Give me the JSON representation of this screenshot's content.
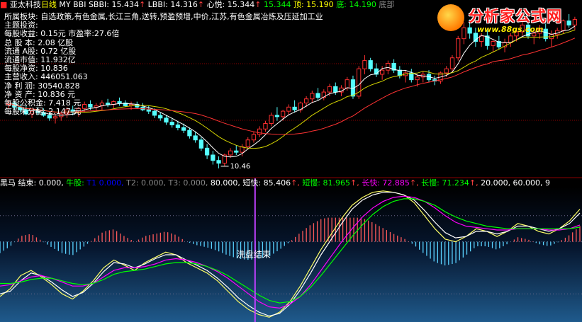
{
  "stock": {
    "name": "亚太科技",
    "period": "日线",
    "indicator": "MY BBI",
    "items": [
      {
        "label": "SBBI: ",
        "value": "15.434",
        "arrow": "↑",
        "color": "#ffffff"
      },
      {
        "label": "LBBI: ",
        "value": "14.316",
        "arrow": "↑",
        "color": "#ffffff"
      },
      {
        "label": "心悦: ",
        "value": "15.344",
        "arrow": "↑",
        "color": "#ffffff"
      },
      {
        "label": "",
        "value": "15.344",
        "arrow": "",
        "color": "#00ff00"
      },
      {
        "label": "顶: ",
        "value": "15.190",
        "arrow": "",
        "color": "#ffff00"
      },
      {
        "label": "底: ",
        "value": "14.190",
        "arrow": "",
        "color": "#00ff00"
      },
      {
        "label": "底部",
        "value": "",
        "arrow": "",
        "color": "#888888"
      }
    ]
  },
  "info_panel": [
    "所属板块: 自选政策,有色金属,长江三角,送转,预盈预增,中价,江苏,有色金属冶炼及压延加工业",
    "主题投资:",
    "每股收益: 0.15元  市盈率:27.6倍",
    "总 股 本: 2.08  亿股",
    "流通 A股: 0.72  亿股",
    "流通市值: 11.932亿",
    "每股净资: 10.836",
    "主营收入: 446051.063",
    "净 利 润: 30540.828",
    "净 资 产: 10.836 元",
    "每股公积金: 7.418 元",
    "每股未分配: 2.147 元"
  ],
  "logo": {
    "title": "分析家公式网",
    "url": "www.88gs.com"
  },
  "indicator_header": [
    {
      "text": "黑马 ",
      "color": "#ffffff"
    },
    {
      "text": "结束: 0.000, ",
      "color": "#ffffff"
    },
    {
      "text": "牛股: ",
      "color": "#00ff00"
    },
    {
      "text": "T1 ",
      "color": "#0000ff"
    },
    {
      "text": "0.000, ",
      "color": "#0000ff"
    },
    {
      "text": "T2: 0.000, ",
      "color": "#888888"
    },
    {
      "text": "T3: 0.000, ",
      "color": "#888888"
    },
    {
      "text": "80.000, ",
      "color": "#ffffff"
    },
    {
      "text": "短快: 85.406",
      "color": "#ffffff"
    },
    {
      "text": "↑, ",
      "color": "#ff4040"
    },
    {
      "text": "短慢: 81.965",
      "color": "#00ff00"
    },
    {
      "text": "↑, ",
      "color": "#ff4040"
    },
    {
      "text": "长快: 72.885",
      "color": "#ff00ff"
    },
    {
      "text": "↑, ",
      "color": "#ff4040"
    },
    {
      "text": "长慢: 71.234",
      "color": "#00ff00"
    },
    {
      "text": "↑, ",
      "color": "#ff4040"
    },
    {
      "text": "20.000, 60.000, ",
      "color": "#ffffff"
    },
    {
      "text": "9",
      "color": "#ffffff"
    }
  ],
  "chart_data": [
    {
      "type": "candlestick",
      "title": "亚太科技 日线",
      "low_annotation": "10.46",
      "ylim": [
        10.2,
        16.2
      ],
      "candles": [
        [
          12.8,
          12.95,
          12.65,
          12.85
        ],
        [
          12.85,
          12.9,
          12.6,
          12.7
        ],
        [
          12.7,
          12.8,
          12.5,
          12.6
        ],
        [
          12.6,
          12.75,
          12.4,
          12.45
        ],
        [
          12.45,
          12.6,
          12.3,
          12.55
        ],
        [
          12.55,
          12.7,
          12.4,
          12.5
        ],
        [
          12.5,
          12.65,
          12.35,
          12.4
        ],
        [
          12.4,
          12.55,
          12.2,
          12.3
        ],
        [
          12.3,
          12.45,
          12.1,
          12.35
        ],
        [
          12.35,
          12.5,
          12.2,
          12.45
        ],
        [
          12.45,
          12.7,
          12.3,
          12.6
        ],
        [
          12.6,
          12.75,
          12.4,
          12.5
        ],
        [
          12.5,
          12.7,
          12.35,
          12.65
        ],
        [
          12.65,
          12.9,
          12.5,
          12.8
        ],
        [
          12.8,
          12.95,
          12.6,
          12.7
        ],
        [
          12.7,
          12.85,
          12.55,
          12.75
        ],
        [
          12.75,
          12.95,
          12.6,
          12.85
        ],
        [
          12.85,
          13.0,
          12.7,
          12.8
        ],
        [
          12.8,
          12.95,
          12.65,
          12.9
        ],
        [
          12.9,
          13.05,
          12.75,
          12.85
        ],
        [
          12.85,
          12.95,
          12.7,
          12.75
        ],
        [
          12.75,
          12.9,
          12.6,
          12.8
        ],
        [
          12.8,
          12.9,
          12.65,
          12.7
        ],
        [
          12.7,
          12.85,
          12.55,
          12.6
        ],
        [
          12.6,
          12.75,
          12.45,
          12.55
        ],
        [
          12.55,
          12.65,
          12.3,
          12.4
        ],
        [
          12.4,
          12.5,
          12.2,
          12.3
        ],
        [
          12.3,
          12.4,
          12.05,
          12.15
        ],
        [
          12.15,
          12.3,
          11.95,
          12.05
        ],
        [
          12.05,
          12.2,
          11.85,
          11.95
        ],
        [
          11.95,
          12.1,
          11.75,
          11.85
        ],
        [
          11.85,
          11.95,
          11.55,
          11.65
        ],
        [
          11.65,
          11.8,
          11.4,
          11.5
        ],
        [
          11.5,
          11.6,
          11.1,
          11.2
        ],
        [
          11.2,
          11.35,
          10.8,
          10.95
        ],
        [
          10.95,
          11.1,
          10.6,
          10.75
        ],
        [
          10.75,
          10.9,
          10.46,
          10.65
        ],
        [
          10.65,
          11.0,
          10.55,
          10.95
        ],
        [
          10.95,
          11.2,
          10.85,
          11.1
        ],
        [
          11.1,
          11.3,
          10.95,
          11.05
        ],
        [
          11.05,
          11.35,
          10.9,
          11.25
        ],
        [
          11.25,
          11.6,
          11.15,
          11.5
        ],
        [
          11.5,
          11.8,
          11.4,
          11.7
        ],
        [
          11.7,
          12.0,
          11.6,
          11.9
        ],
        [
          11.9,
          12.2,
          11.8,
          12.1
        ],
        [
          12.1,
          12.5,
          12.0,
          12.4
        ],
        [
          12.4,
          12.7,
          12.2,
          12.35
        ],
        [
          12.35,
          12.6,
          12.2,
          12.55
        ],
        [
          12.55,
          12.8,
          12.4,
          12.7
        ],
        [
          12.7,
          12.95,
          12.5,
          12.6
        ],
        [
          12.6,
          12.9,
          12.5,
          12.85
        ],
        [
          12.85,
          13.1,
          12.7,
          13.0
        ],
        [
          13.0,
          13.3,
          12.85,
          13.2
        ],
        [
          13.2,
          13.4,
          12.95,
          13.05
        ],
        [
          13.05,
          13.35,
          12.95,
          13.25
        ],
        [
          13.25,
          13.55,
          13.1,
          13.45
        ],
        [
          13.45,
          13.6,
          13.15,
          13.25
        ],
        [
          13.25,
          13.5,
          13.1,
          13.4
        ],
        [
          13.4,
          13.8,
          13.3,
          13.7
        ],
        [
          13.7,
          13.85,
          13.0,
          13.1
        ],
        [
          13.1,
          14.2,
          13.0,
          14.1
        ],
        [
          14.1,
          14.6,
          13.9,
          14.4
        ],
        [
          14.4,
          14.5,
          14.0,
          14.1
        ],
        [
          14.1,
          14.3,
          13.8,
          13.9
        ],
        [
          13.9,
          14.2,
          13.7,
          14.05
        ],
        [
          14.05,
          14.4,
          13.9,
          14.3
        ],
        [
          14.3,
          14.45,
          13.95,
          14.05
        ],
        [
          14.05,
          14.2,
          13.75,
          13.85
        ],
        [
          13.85,
          14.05,
          13.6,
          13.95
        ],
        [
          13.95,
          14.1,
          13.6,
          13.7
        ],
        [
          13.7,
          13.9,
          13.45,
          13.8
        ],
        [
          13.8,
          14.0,
          13.6,
          13.9
        ],
        [
          13.9,
          14.05,
          13.6,
          13.7
        ],
        [
          13.7,
          13.85,
          13.5,
          13.65
        ],
        [
          13.65,
          14.0,
          13.55,
          13.95
        ],
        [
          13.95,
          14.2,
          13.8,
          14.1
        ],
        [
          14.1,
          14.6,
          14.0,
          14.5
        ],
        [
          14.5,
          15.3,
          14.4,
          15.2
        ],
        [
          15.2,
          15.8,
          15.0,
          15.6
        ],
        [
          15.6,
          15.9,
          15.2,
          15.4
        ],
        [
          15.4,
          15.6,
          14.9,
          15.1
        ],
        [
          15.1,
          15.4,
          14.9,
          15.3
        ],
        [
          15.3,
          15.5,
          14.8,
          14.95
        ],
        [
          14.95,
          15.2,
          14.7,
          15.1
        ],
        [
          15.1,
          15.3,
          14.8,
          14.9
        ],
        [
          14.9,
          15.2,
          14.7,
          15.05
        ],
        [
          15.05,
          15.4,
          14.9,
          15.3
        ],
        [
          15.3,
          15.6,
          15.1,
          15.45
        ],
        [
          15.45,
          15.9,
          15.3,
          15.7
        ],
        [
          15.7,
          15.8,
          15.2,
          15.3
        ],
        [
          15.3,
          15.5,
          15.0,
          15.4
        ],
        [
          15.4,
          15.7,
          15.2,
          15.55
        ],
        [
          15.55,
          15.75,
          15.1,
          15.2
        ],
        [
          15.2,
          15.5,
          14.9,
          15.35
        ],
        [
          15.35,
          15.6,
          15.2,
          15.5
        ],
        [
          15.5,
          15.9,
          15.4,
          15.85
        ],
        [
          15.85,
          16.1,
          15.6,
          15.7
        ],
        [
          15.7,
          16.0,
          15.5,
          15.9
        ]
      ]
    },
    {
      "type": "line",
      "title": "黑马",
      "ylim": [
        0,
        100
      ],
      "reference_lines": [
        20,
        60,
        80
      ],
      "annotation": "洗盘结束",
      "series": [
        {
          "name": "短快",
          "color": "#ffff66",
          "values": [
            18,
            24,
            34,
            38,
            33,
            27,
            20,
            16,
            22,
            30,
            40,
            46,
            42,
            38,
            44,
            48,
            52,
            50,
            44,
            40,
            36,
            30,
            22,
            14,
            8,
            4,
            2,
            6,
            14,
            26,
            40,
            54,
            66,
            78,
            88,
            94,
            98,
            99,
            98,
            96,
            90,
            80,
            70,
            62,
            60,
            64,
            70,
            68,
            64,
            68,
            74,
            72,
            68,
            66,
            70,
            76,
            85
          ]
        },
        {
          "name": "短慢",
          "color": "#ffffff",
          "values": [
            20,
            22,
            30,
            36,
            34,
            29,
            23,
            18,
            21,
            28,
            37,
            44,
            43,
            40,
            43,
            47,
            50,
            50,
            46,
            42,
            38,
            32,
            25,
            17,
            11,
            6,
            3,
            5,
            12,
            23,
            36,
            50,
            62,
            74,
            85,
            92,
            96,
            98,
            98,
            96,
            92,
            84,
            75,
            67,
            63,
            64,
            68,
            68,
            66,
            68,
            72,
            72,
            70,
            68,
            70,
            74,
            82
          ]
        },
        {
          "name": "长快",
          "color": "#ff00ff",
          "values": [
            26,
            27,
            30,
            33,
            34,
            32,
            29,
            26,
            26,
            28,
            33,
            38,
            40,
            40,
            41,
            43,
            46,
            47,
            46,
            44,
            41,
            37,
            32,
            26,
            20,
            14,
            10,
            9,
            12,
            18,
            27,
            38,
            49,
            60,
            70,
            79,
            86,
            91,
            94,
            95,
            94,
            91,
            86,
            80,
            75,
            72,
            71,
            70,
            69,
            69,
            70,
            70,
            70,
            69,
            69,
            70,
            72.9
          ]
        },
        {
          "name": "长慢",
          "color": "#00ff00",
          "values": [
            28,
            28,
            29,
            31,
            32,
            32,
            30,
            28,
            27,
            28,
            31,
            35,
            37,
            38,
            39,
            41,
            43,
            44,
            44,
            43,
            41,
            38,
            34,
            29,
            24,
            19,
            15,
            13,
            14,
            18,
            25,
            34,
            44,
            54,
            64,
            73,
            81,
            87,
            91,
            93,
            93,
            91,
            88,
            83,
            79,
            76,
            74,
            72,
            71,
            70,
            70,
            70,
            70,
            70,
            70,
            70,
            71.2
          ]
        }
      ]
    }
  ]
}
